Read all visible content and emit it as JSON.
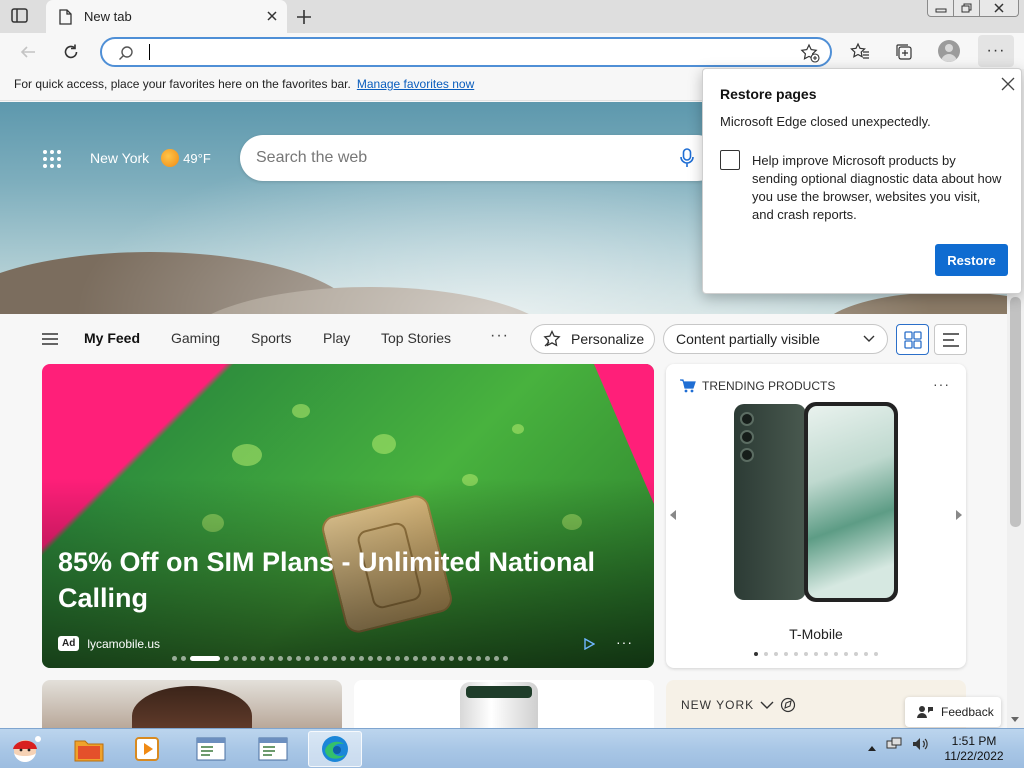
{
  "browser": {
    "tab": {
      "title": "New tab"
    },
    "address": {
      "value": "",
      "placeholder": ""
    }
  },
  "favorites_bar": {
    "message": "For quick access, place your favorites here on the favorites bar.",
    "link": "Manage favorites now"
  },
  "hero": {
    "location": "New York",
    "temperature": "49°F",
    "search_placeholder": "Search the web"
  },
  "feed_nav": {
    "tabs": [
      "My Feed",
      "Gaming",
      "Sports",
      "Play",
      "Top Stories"
    ],
    "more": "···",
    "personalize": "Personalize",
    "content_visibility": "Content partially visible"
  },
  "big_card": {
    "headline": "85% Off on SIM Plans - Unlimited National Calling",
    "ad_badge": "Ad",
    "source": "lycamobile.us",
    "carousel_index": 2,
    "carousel_total": 35
  },
  "trending_card": {
    "header": "TRENDING PRODUCTS",
    "product_label": "T-Mobile",
    "page_index": 0,
    "page_total": 13
  },
  "bottom_cards": {
    "weather_city": "NEW YORK"
  },
  "feedback": {
    "label": "Feedback"
  },
  "restore_dialog": {
    "title": "Restore pages",
    "message": "Microsoft Edge closed unexpectedly.",
    "checkbox_label": "Help improve Microsoft products by sending optional diagnostic data about how you use the browser, websites you visit, and crash reports.",
    "checkbox_checked": false,
    "button": "Restore"
  },
  "taskbar": {
    "time": "1:51 PM",
    "date": "11/22/2022"
  },
  "colors": {
    "accent": "#0f6cd1",
    "link": "#0a5dbd",
    "ad_pink": "#ff1f79"
  }
}
